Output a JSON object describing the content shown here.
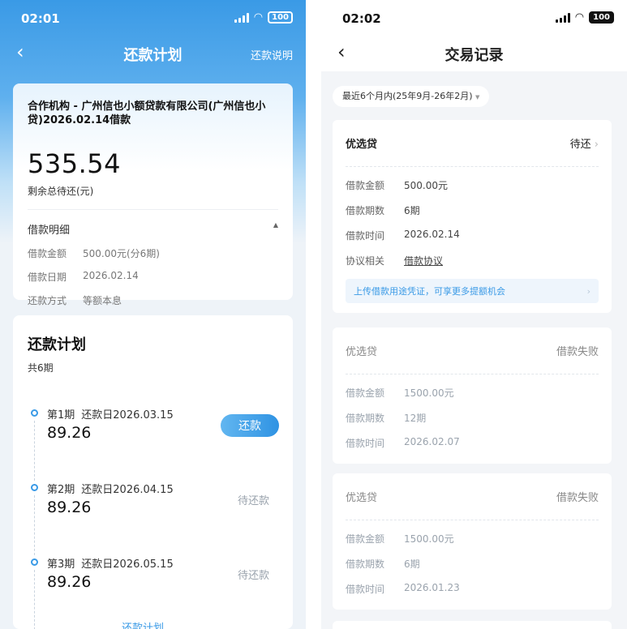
{
  "left": {
    "status": {
      "time": "02:01",
      "battery": "100"
    },
    "nav": {
      "title": "还款计划",
      "help": "还款说明"
    },
    "loan": {
      "org": "合作机构 - 广州信也小额贷款有限公司(广州信也小贷)2026.02.14借款",
      "remaining_amount": "535.54",
      "remaining_label": "剩余总待还(元)",
      "detail_title": "借款明细",
      "rows": [
        {
          "k": "借款金额",
          "v": "500.00元(分6期)"
        },
        {
          "k": "借款日期",
          "v": "2026.02.14"
        },
        {
          "k": "还款方式",
          "v": "等额本息"
        }
      ]
    },
    "plan": {
      "title": "还款计划",
      "count": "共6期",
      "periods": [
        {
          "name": "第1期",
          "due": "还款日2026.03.15",
          "amount": "89.26",
          "action": "还款"
        },
        {
          "name": "第2期",
          "due": "还款日2026.04.15",
          "amount": "89.26",
          "status": "待还款"
        },
        {
          "name": "第3期",
          "due": "还款日2026.05.15",
          "amount": "89.26",
          "status": "待还款"
        }
      ],
      "bottom_peek": "还款计划"
    }
  },
  "right": {
    "status": {
      "time": "02:02",
      "battery": "100"
    },
    "nav": {
      "title": "交易记录"
    },
    "filter": "最近6个月内(25年9月-26年2月)",
    "records": [
      {
        "name": "优选贷",
        "status": "待还",
        "rows": [
          {
            "k": "借款金额",
            "v": "500.00元"
          },
          {
            "k": "借款期数",
            "v": "6期"
          },
          {
            "k": "借款时间",
            "v": "2026.02.14"
          },
          {
            "k": "协议相关",
            "v": "借款协议"
          }
        ],
        "upload": "上传借款用途凭证，可享更多提额机会"
      },
      {
        "name": "优选贷",
        "status": "借款失败",
        "rows": [
          {
            "k": "借款金额",
            "v": "1500.00元"
          },
          {
            "k": "借款期数",
            "v": "12期"
          },
          {
            "k": "借款时间",
            "v": "2026.02.07"
          }
        ]
      },
      {
        "name": "优选贷",
        "status": "借款失败",
        "rows": [
          {
            "k": "借款金额",
            "v": "1500.00元"
          },
          {
            "k": "借款期数",
            "v": "6期"
          },
          {
            "k": "借款时间",
            "v": "2026.01.23"
          }
        ]
      }
    ]
  },
  "icons": {
    "back": "chevron-left-icon",
    "collapse": "caret-up-icon",
    "forward": "chevron-right-icon",
    "dropdown": "caret-down-icon"
  }
}
